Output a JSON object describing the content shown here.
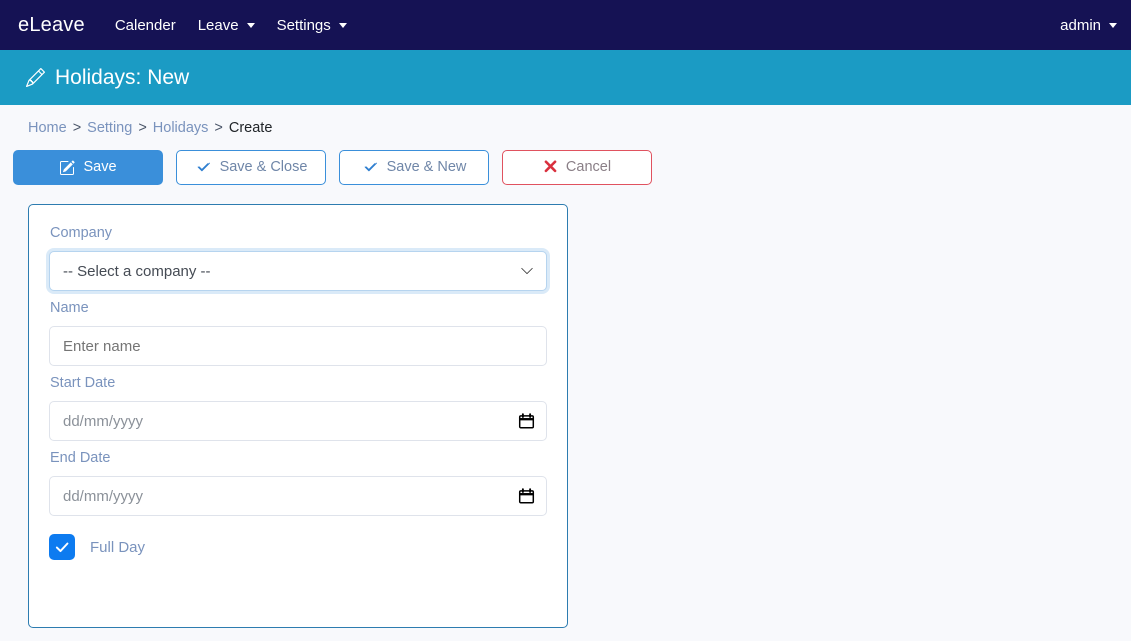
{
  "navbar": {
    "brand": "eLeave",
    "items": [
      {
        "label": "Calender",
        "has_caret": false
      },
      {
        "label": "Leave",
        "has_caret": true
      },
      {
        "label": "Settings",
        "has_caret": true
      }
    ],
    "user": {
      "label": "admin",
      "has_caret": true
    },
    "bg_color": "#151254"
  },
  "banner": {
    "title": "Holidays: New",
    "icon": "pencil-icon",
    "bg_color": "#1b9bc4"
  },
  "breadcrumb": {
    "items": [
      {
        "label": "Home",
        "is_link": true
      },
      {
        "label": "Setting",
        "is_link": true
      },
      {
        "label": "Holidays",
        "is_link": true
      },
      {
        "label": "Create",
        "is_link": false
      }
    ],
    "separator": ">"
  },
  "toolbar": {
    "save_label": "Save",
    "save_icon": "pencil-square-icon",
    "save_close_label": "Save & Close",
    "save_close_icon": "check-icon",
    "save_new_label": "Save & New",
    "save_new_icon": "check-icon",
    "cancel_label": "Cancel",
    "cancel_icon": "x-icon",
    "primary_color": "#3a8fda",
    "danger_color": "#e0525f"
  },
  "form": {
    "company": {
      "label": "Company",
      "selected": "-- Select a company --",
      "icon": "chevron-down-icon"
    },
    "name": {
      "label": "Name",
      "value": "",
      "placeholder": "Enter name"
    },
    "start_date": {
      "label": "Start Date",
      "value": "",
      "placeholder": "dd/mm/yyyy",
      "icon": "calendar-icon"
    },
    "end_date": {
      "label": "End Date",
      "value": "",
      "placeholder": "dd/mm/yyyy",
      "icon": "calendar-icon"
    },
    "full_day": {
      "label": "Full Day",
      "checked": true,
      "icon": "check-icon",
      "accent_color": "#0d7bf0"
    }
  }
}
